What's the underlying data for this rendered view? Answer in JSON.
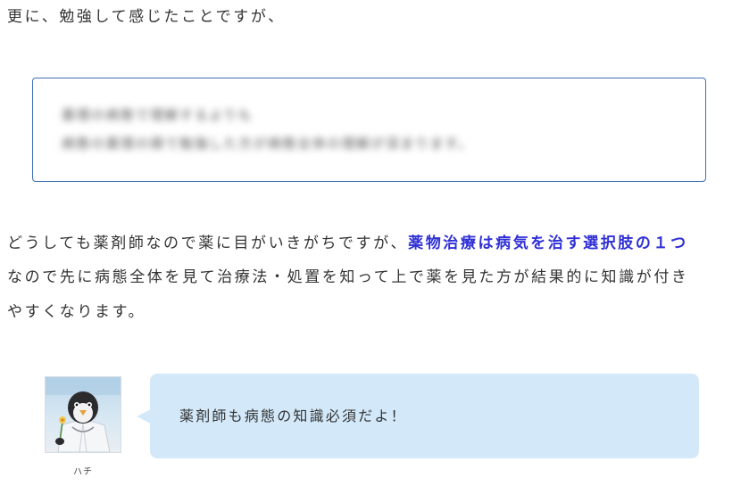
{
  "intro": "更に、勉強して感じたことですが、",
  "blurred_quote": {
    "line1": "薬理の病態で理解するよりも",
    "line2": "病態の薬理の順で勉強した方が病態全体の理解が深まります。"
  },
  "body": {
    "line1_before": "どうしても薬剤師なので薬に目がいきがちですが、",
    "line1_highlight": "薬物治療は病気を治す選択肢の１つ",
    "line2": "なので先に病態全体を見て治療法・処置を知って上で薬を見た方が結果的に知識が付き",
    "line3": "やすくなります。"
  },
  "speech": {
    "speaker_name": "ハチ",
    "text": "薬剤師も病態の知識必須だよ！",
    "avatar_icon": "penguin-doctor-icon"
  },
  "colors": {
    "highlight": "#2f2fd6",
    "bubble": "#d3e9fa",
    "box_border": "#3f6fb5"
  }
}
